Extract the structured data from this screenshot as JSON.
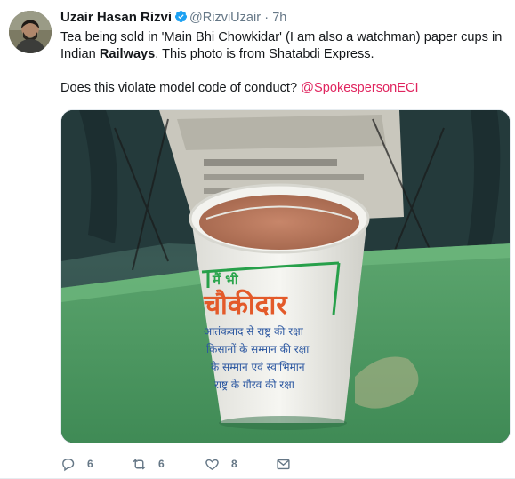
{
  "tweet": {
    "author_name": "Uzair Hasan Rizvi",
    "handle": "@RizviUzair",
    "separator": "·",
    "time": "7h",
    "text_line1": "Tea being sold in 'Main Bhi Chowkidar' (I am also a watchman) paper cups in",
    "text_line2_pre": "Indian ",
    "text_line2_bold": "Railways",
    "text_line2_post": ". This photo is from Shatabdi Express.",
    "text_line3_pre": "Does this violate model code of conduct? ",
    "text_mention": "@SpokespersonECI"
  },
  "cup": {
    "slogan_top": "मैं भी",
    "slogan_main": "चौकीदार",
    "line1": "आतंकवाद से राष्ट्र की रक्षा",
    "line2": "किसानों के सम्मान की रक्षा",
    "line3": "के सम्मान एवं स्वाभिमान",
    "line4": "राष्ट्र के गौरव की रक्षा"
  },
  "actions": {
    "reply_count": "6",
    "retweet_count": "6",
    "like_count": "8"
  },
  "colors": {
    "accent": "#e0245e",
    "verified": "#1da1f2",
    "muted": "#657786"
  }
}
